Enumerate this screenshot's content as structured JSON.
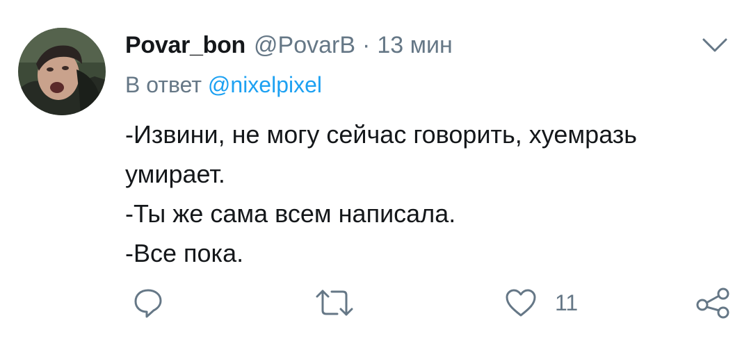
{
  "tweet": {
    "display_name": "Povar_bon",
    "handle": "@PovarB",
    "separator": "·",
    "time": "13 мин",
    "reply_prefix": "В ответ",
    "reply_mention": "@nixelpixel",
    "text_lines": [
      "-Извини, не могу сейчас говорить, хуемразь",
      "умирает.",
      "-Ты же сама всем написала.",
      "-Все пока."
    ]
  },
  "actions": {
    "like_count": "11",
    "icons": [
      "reply-icon",
      "retweet-icon",
      "like-icon",
      "share-icon"
    ]
  },
  "colors": {
    "text": "#14171a",
    "secondary": "#657786",
    "link": "#1da1f2"
  }
}
